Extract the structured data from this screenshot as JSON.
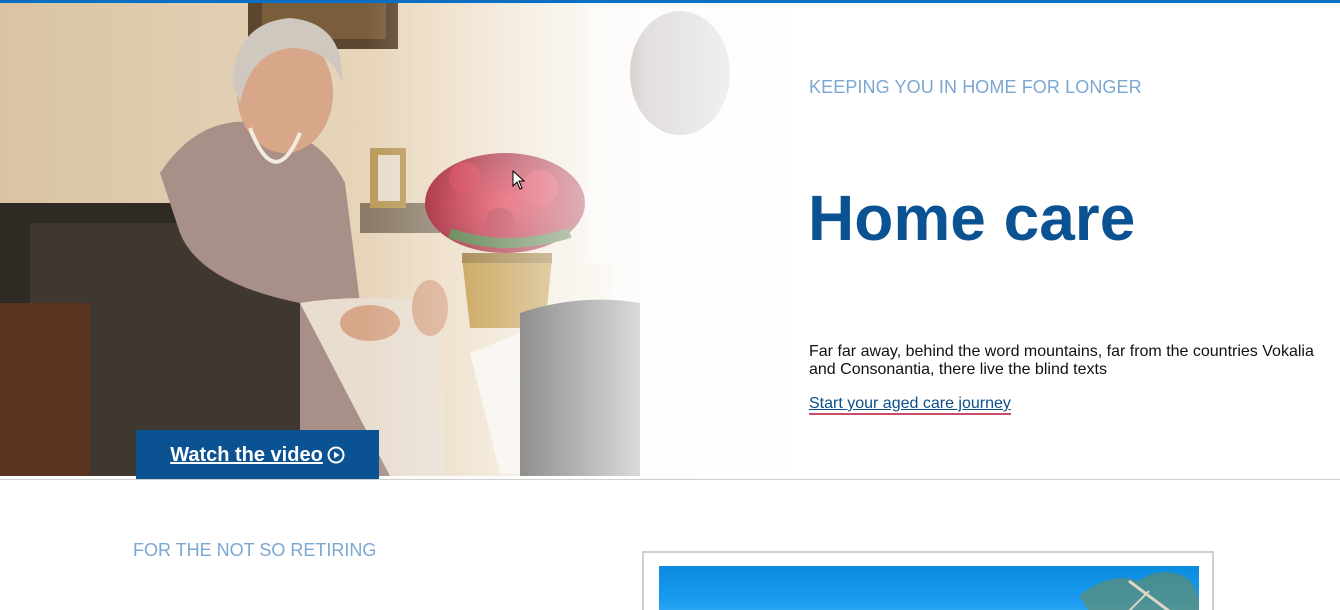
{
  "hero": {
    "eyebrow": "KEEPING YOU IN HOME FOR LONGER",
    "title": "Home care",
    "description": "Far far away, behind the word mountains, far from the countries Vokalia and Consonantia, there live the blind texts",
    "link_label": "Start your aged care journey",
    "watch_label": "Watch the video"
  },
  "section2": {
    "eyebrow": "FOR THE NOT SO RETIRING"
  },
  "colors": {
    "brand_blue": "#0b5293",
    "eyebrow": "#7ba7d3",
    "top_bar": "#0a6fc2",
    "link_underline": "#c94a6a"
  },
  "icons": {
    "play": "play-circle-icon"
  }
}
